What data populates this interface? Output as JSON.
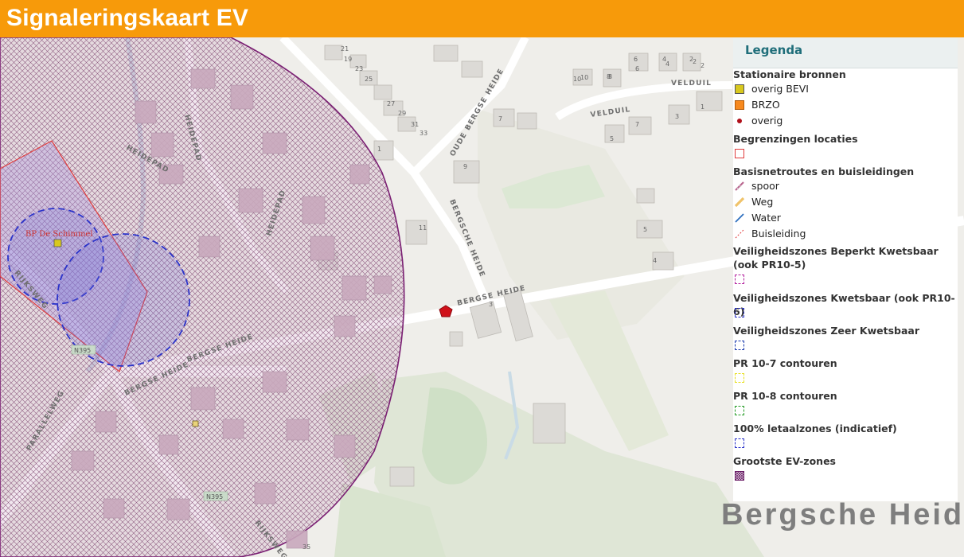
{
  "header": {
    "title": "Signaleringskaart EV",
    "color": "#f79a0a"
  },
  "legend": {
    "title": "Legenda",
    "groups": [
      {
        "label": "Stationaire bronnen",
        "items": [
          "overig BEVI",
          "BRZO",
          "overig"
        ]
      },
      {
        "label": "Begrenzingen locaties",
        "items": []
      },
      {
        "label": "Basisnetroutes en buisleidingen",
        "items": [
          "spoor",
          "Weg",
          "Water",
          "Buisleiding"
        ]
      },
      {
        "label": "Veiligheidszones Beperkt Kwetsbaar (ook PR10-5)",
        "items": []
      },
      {
        "label": "Veiligheidszones Kwetsbaar (ook PR10-6)",
        "items": []
      },
      {
        "label": "Veiligheidszones Zeer Kwetsbaar",
        "items": []
      },
      {
        "label": "PR 10-7 contouren",
        "items": []
      },
      {
        "label": "PR 10-8 contouren",
        "items": []
      },
      {
        "label": "100% letaalzones (indicatief)",
        "items": []
      },
      {
        "label": "Grootste EV-zones",
        "items": []
      }
    ]
  },
  "map": {
    "place_label": "BP De Schimmel",
    "area_label": "Bergsche Heid",
    "streets": [
      "HEIDEPAD",
      "HEIDEPAD",
      "HEIDEPAD",
      "OUDE BERGSE HEIDE",
      "BERGSCHE HEIDE",
      "BERGSE HEIDE",
      "BERGSE HEIDE",
      "BERGSE HEIDE",
      "VELDUIL",
      "VELDUIL",
      "PARALLELWEG",
      "RIJKSWEG",
      "RIJKSWEG"
    ],
    "road_numbers": [
      "N395",
      "N395"
    ],
    "house_numbers": [
      "21",
      "19",
      "23",
      "25",
      "27",
      "29",
      "31",
      "33",
      "6",
      "8",
      "10",
      "4",
      "2",
      "7",
      "3",
      "5",
      "1",
      "7",
      "9",
      "11",
      "3",
      "5",
      "4",
      "1",
      "2",
      "35",
      "10",
      "8",
      "6",
      "4",
      "2"
    ],
    "colors": {
      "ev_zone": "#7a1f73",
      "lethal_zone": "#2b33c9",
      "location_border": "#e03c3c",
      "bevi": "#d8c81e",
      "overig_marker": "#d0111a"
    }
  }
}
